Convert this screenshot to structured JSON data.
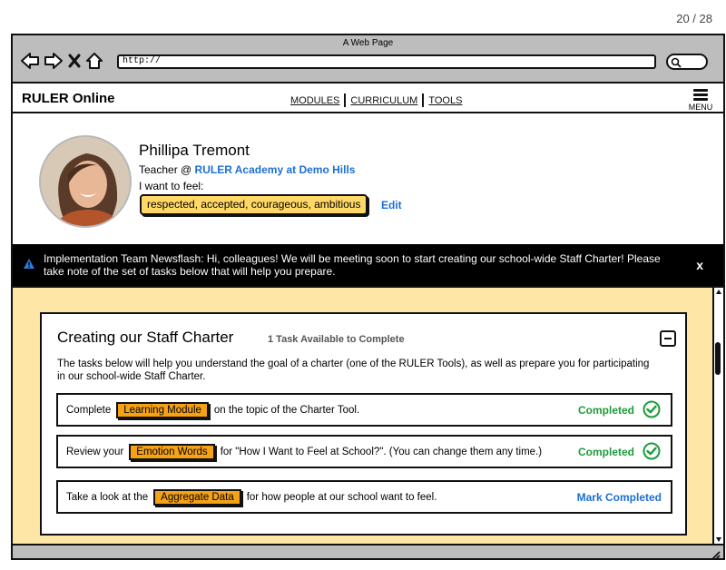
{
  "page_counter": "20 / 28",
  "window": {
    "title": "A Web Page",
    "url": "http://"
  },
  "app": {
    "brand": "RULER Online",
    "nav": [
      {
        "label": "MODULES"
      },
      {
        "label": "CURRICULUM"
      },
      {
        "label": "TOOLS"
      }
    ],
    "menu_label": "MENU"
  },
  "profile": {
    "name": "Phillipa Tremont",
    "role_prefix": "Teacher @ ",
    "school": "RULER Academy at Demo Hills",
    "feel_label": "I want to feel:",
    "feelings": "respected, accepted, courageous, ambitious",
    "edit_label": "Edit"
  },
  "banner": {
    "text": "Implementation Team Newsflash: Hi, colleagues! We will be meeting soon to start creating our school-wide Staff Charter! Please take note of the set of tasks below that will help you prepare.",
    "close": "x"
  },
  "card": {
    "title": "Creating our Staff Charter",
    "subtitle": "1 Task Available to Complete",
    "description": "The tasks below will help you understand the goal of a charter (one of the RULER Tools), as well as prepare you for participating in our school-wide Staff Charter.",
    "tasks": [
      {
        "before": "Complete",
        "chip": "Learning Module",
        "after": "on the topic of the Charter Tool.",
        "status": "Completed"
      },
      {
        "before": "Review your",
        "chip": "Emotion Words",
        "after": "for \"How I Want to Feel at School?\". (You can change them any time.)",
        "status": "Completed"
      },
      {
        "before": "Take a look at the",
        "chip": "Aggregate Data",
        "after": "for how people at our school want to feel.",
        "action": "Mark Completed"
      }
    ]
  },
  "colors": {
    "accent_blue": "#1d6fd6",
    "success_green": "#1d9b3a",
    "highlight_yellow": "#ffd866",
    "chip_orange": "#f5a315",
    "content_bg": "#fde6a6",
    "banner_bg": "#000000"
  }
}
